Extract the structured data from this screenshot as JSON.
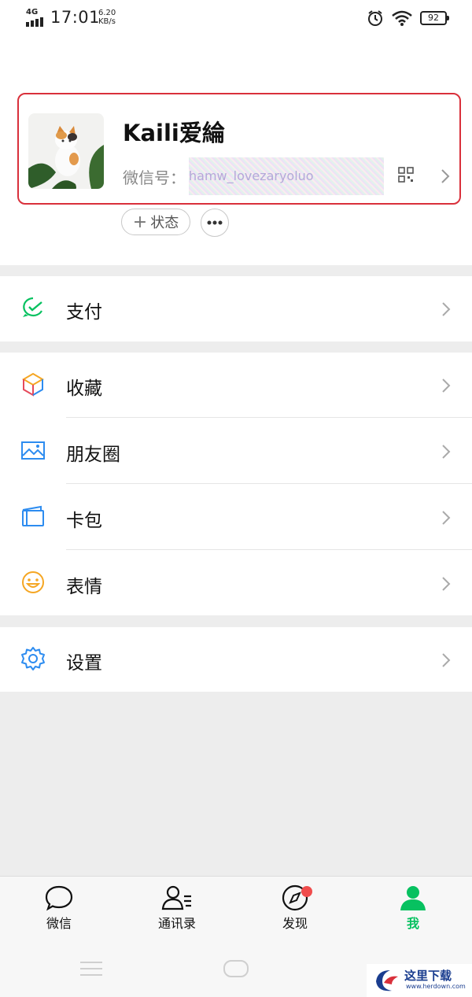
{
  "status_bar": {
    "network": "4G",
    "time": "17:01",
    "speed_value": "6.20",
    "speed_unit": "KB/s",
    "battery": "92"
  },
  "profile": {
    "nickname": "Kaili爱綸",
    "wechat_id_label": "微信号：",
    "wechat_id_value": "hamw_lovezaryoluo",
    "status_button_label": "状态"
  },
  "menu_groups": [
    [
      {
        "label": "支付",
        "icon": "pay-icon"
      }
    ],
    [
      {
        "label": "收藏",
        "icon": "favorites-icon"
      },
      {
        "label": "朋友圈",
        "icon": "moments-icon"
      },
      {
        "label": "卡包",
        "icon": "card-wallet-icon"
      },
      {
        "label": "表情",
        "icon": "sticker-icon"
      }
    ],
    [
      {
        "label": "设置",
        "icon": "settings-icon"
      }
    ]
  ],
  "tabs": [
    {
      "label": "微信",
      "icon": "chat-icon",
      "active": false
    },
    {
      "label": "通讯录",
      "icon": "contacts-icon",
      "active": false
    },
    {
      "label": "发现",
      "icon": "discover-icon",
      "active": false,
      "badge": true
    },
    {
      "label": "我",
      "icon": "me-icon",
      "active": true
    }
  ],
  "watermark": {
    "title": "这里下载",
    "url": "www.herdown.com"
  },
  "colors": {
    "accent_green": "#07c160",
    "highlight_red": "#d9303b",
    "badge_red": "#f04c4c"
  }
}
